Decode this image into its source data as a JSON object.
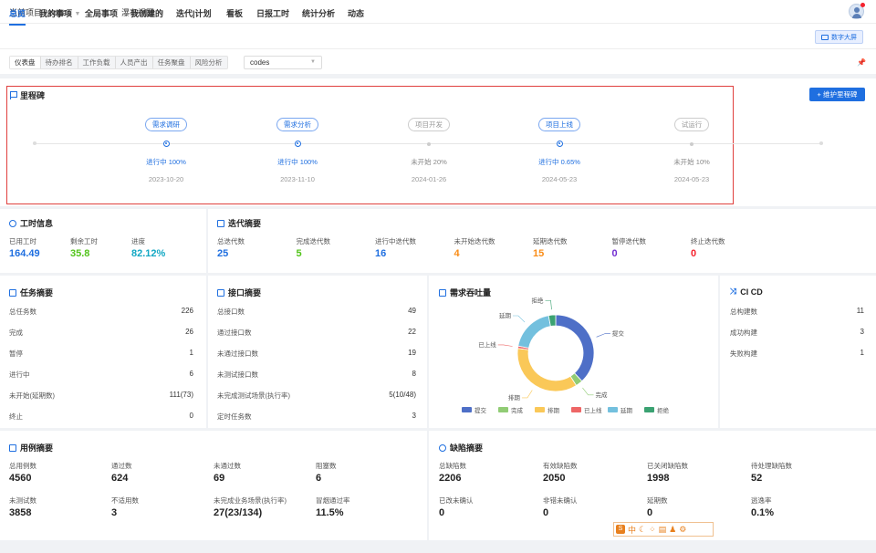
{
  "topbar": {
    "project_label": "当前项目 / codes",
    "view_label": "瀑布视图"
  },
  "nav": {
    "items": [
      "总览",
      "我的事项",
      "全局事项",
      "我创建的",
      "迭代|计划",
      "看板",
      "日报工时",
      "统计分析",
      "动态"
    ],
    "active": 0,
    "screen_btn": "数字大屏"
  },
  "subtabs": {
    "items": [
      "仪表盘",
      "待办排名",
      "工作负载",
      "人员产出",
      "任务聚盘",
      "风险分析"
    ],
    "active": 0,
    "select_value": "codes"
  },
  "milestones": {
    "title": "里程碑",
    "maintain_btn": "+ 维护里程碑",
    "items": [
      {
        "name": "需求调研",
        "status": "进行中 100%",
        "date": "2023-10-20",
        "active": true,
        "pos": 182
      },
      {
        "name": "需求分析",
        "status": "进行中 100%",
        "date": "2023-11-10",
        "active": true,
        "pos": 326
      },
      {
        "name": "项目开发",
        "status": "未开始 20%",
        "date": "2024-01-26",
        "active": false,
        "pos": 470
      },
      {
        "name": "项目上线",
        "status": "进行中 0.65%",
        "date": "2024-05-23",
        "active": true,
        "pos": 613
      },
      {
        "name": "试运行",
        "status": "未开始 10%",
        "date": "2024-05-23",
        "active": false,
        "pos": 758
      }
    ]
  },
  "worktime": {
    "title": "工时信息",
    "used_label": "已用工时",
    "used": "164.49",
    "remain_label": "剩余工时",
    "remain": "35.8",
    "progress_label": "进度",
    "progress": "82.12%"
  },
  "iteration": {
    "title": "迭代摘要",
    "items": [
      {
        "label": "总迭代数",
        "value": "25",
        "color": "#1f6fe0"
      },
      {
        "label": "完成迭代数",
        "value": "5",
        "color": "#52c41a"
      },
      {
        "label": "进行中迭代数",
        "value": "16",
        "color": "#1f6fe0"
      },
      {
        "label": "未开始迭代数",
        "value": "4",
        "color": "#fa8c16"
      },
      {
        "label": "延期迭代数",
        "value": "15",
        "color": "#fa8c16"
      },
      {
        "label": "暂停迭代数",
        "value": "0",
        "color": "#722ed1"
      },
      {
        "label": "终止迭代数",
        "value": "0",
        "color": "#f5222d"
      }
    ]
  },
  "task": {
    "title": "任务摘要",
    "rows": [
      {
        "label": "总任务数",
        "value": "226"
      },
      {
        "label": "完成",
        "value": "26"
      },
      {
        "label": "暂停",
        "value": "1"
      },
      {
        "label": "进行中",
        "value": "6"
      },
      {
        "label": "未开始(延期数)",
        "value": "111(73)"
      },
      {
        "label": "终止",
        "value": "0"
      }
    ]
  },
  "api": {
    "title": "接口摘要",
    "rows": [
      {
        "label": "总接口数",
        "value": "49"
      },
      {
        "label": "通过接口数",
        "value": "22"
      },
      {
        "label": "未通过接口数",
        "value": "19"
      },
      {
        "label": "未测试接口数",
        "value": "8"
      },
      {
        "label": "未完成测试场景(执行率)",
        "value": "5(10/48)"
      },
      {
        "label": "定时任务数",
        "value": "3"
      }
    ]
  },
  "demand": {
    "title": "需求吞吐量"
  },
  "cicd": {
    "title": "CI CD",
    "rows": [
      {
        "label": "总构建数",
        "value": "11"
      },
      {
        "label": "成功构建",
        "value": "3"
      },
      {
        "label": "失败构建",
        "value": "1"
      }
    ]
  },
  "cases": {
    "title": "用例摘要",
    "items": [
      {
        "label": "总用例数",
        "value": "4560"
      },
      {
        "label": "通过数",
        "value": "624"
      },
      {
        "label": "未通过数",
        "value": "69"
      },
      {
        "label": "阻塞数",
        "value": "6"
      },
      {
        "label": "未测试数",
        "value": "3858"
      },
      {
        "label": "不适用数",
        "value": "3"
      },
      {
        "label": "未完成业务场景(执行率)",
        "value": "27(23/134)"
      },
      {
        "label": "冒烟通过率",
        "value": "11.5%"
      }
    ]
  },
  "defect": {
    "title": "缺陷摘要",
    "items": [
      {
        "label": "总缺陷数",
        "value": "2206"
      },
      {
        "label": "有效缺陷数",
        "value": "2050"
      },
      {
        "label": "已关闭缺陷数",
        "value": "1998"
      },
      {
        "label": "待处理缺陷数",
        "value": "52"
      },
      {
        "label": "已改未确认",
        "value": "0"
      },
      {
        "label": "非错未确认",
        "value": "0"
      },
      {
        "label": "延期数",
        "value": "0"
      },
      {
        "label": "逃逸率",
        "value": "0.1%"
      }
    ]
  },
  "chart_data": {
    "type": "pie",
    "categories": [
      "提交",
      "完成",
      "排期",
      "已上线",
      "延期",
      "拒绝"
    ],
    "values": [
      38,
      3,
      36,
      1,
      19,
      3
    ],
    "colors": [
      "#4e6fc7",
      "#91cc75",
      "#fac858",
      "#ee6666",
      "#73c0de",
      "#3ba272"
    ],
    "legend": "bottom"
  },
  "ime": {
    "label": "中"
  }
}
